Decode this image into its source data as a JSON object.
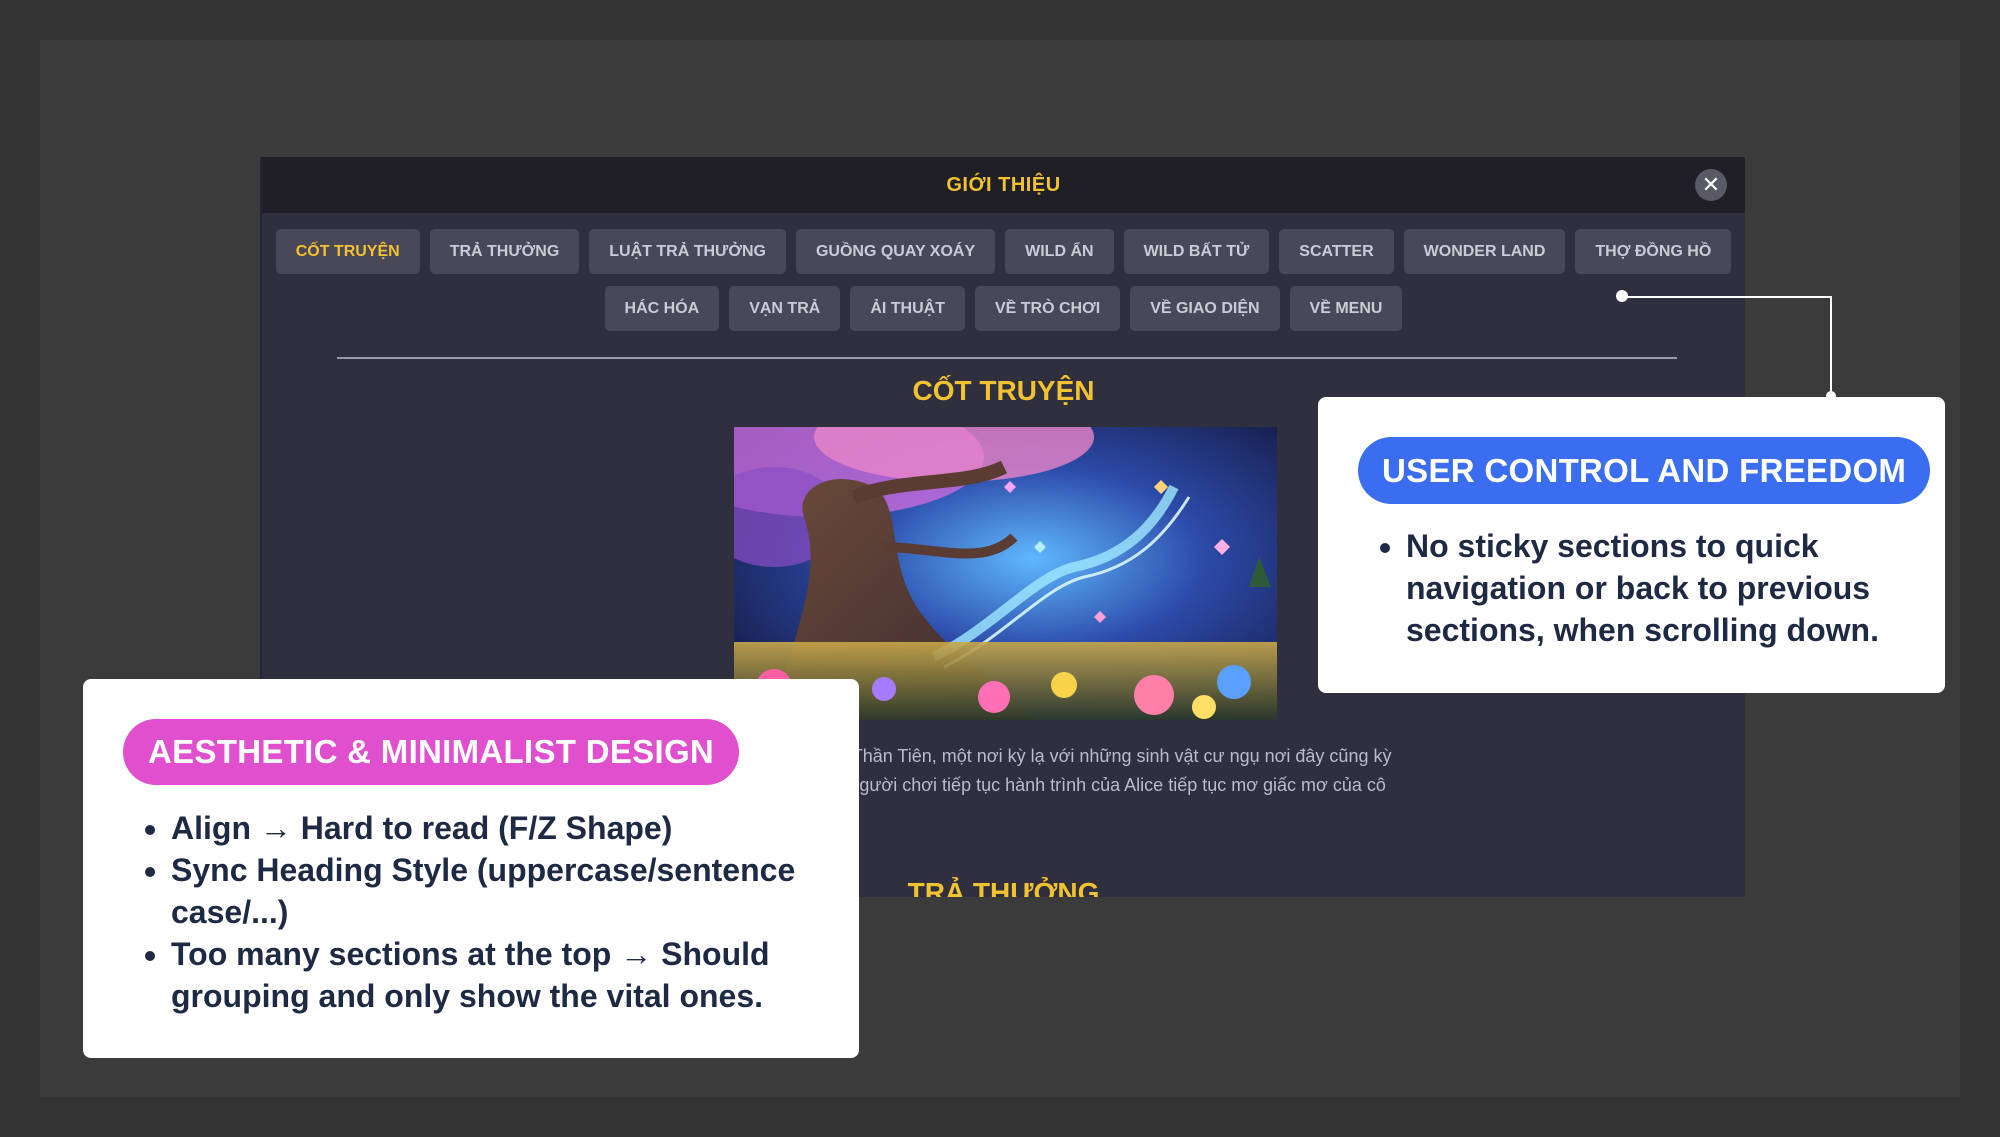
{
  "modal": {
    "title": "GIỚI THIỆU",
    "close_label": "✕",
    "tabs": [
      {
        "label": "CỐT TRUYỆN",
        "active": true
      },
      {
        "label": "TRẢ THƯỞNG",
        "active": false
      },
      {
        "label": "LUẬT TRẢ THƯỞNG",
        "active": false
      },
      {
        "label": "GUỒNG QUAY XOÁY",
        "active": false
      },
      {
        "label": "WILD ẨN",
        "active": false
      },
      {
        "label": "WILD BẤT TỬ",
        "active": false
      },
      {
        "label": "SCATTER",
        "active": false
      },
      {
        "label": "WONDER LAND",
        "active": false
      },
      {
        "label": "THỢ ĐỒNG HỒ",
        "active": false
      },
      {
        "label": "HÁC HÓA",
        "active": false
      },
      {
        "label": "VẠN TRẢ",
        "active": false
      },
      {
        "label": "ẢI THUẬT",
        "active": false
      },
      {
        "label": "VỀ TRÒ CHƠI",
        "active": false
      },
      {
        "label": "VỀ GIAO DIỆN",
        "active": false
      },
      {
        "label": "VỀ MENU",
        "active": false
      }
    ],
    "section_title": "CỐT TRUYỆN",
    "story_line1": "o Thỏ Trắng và bước vào xứ sở Thần Tiên, một nơi kỳ lạ với những sinh vật cư ngụ nơi đây cũng kỳ",
    "story_line2": "hẳng áp dụng được ở nơi đây. Người chơi tiếp tục hành trình của Alice tiếp tục mơ giấc mơ của cô",
    "next_section_title": "TRẢ THƯỞNG"
  },
  "annotations": {
    "right": {
      "heading": "USER CONTROL AND FREEDOM",
      "color": "#3b6df0",
      "points": [
        "No sticky sections to quick navigation or back to previous sections, when scrolling down."
      ]
    },
    "left": {
      "heading": "AESTHETIC & MINIMALIST DESIGN",
      "color": "#e04fce",
      "points": [
        "Align → Hard to read (F/Z Shape)",
        "Sync Heading Style (uppercase/sentence case/...)",
        "Too many sections at the top → Should grouping and only show the vital ones."
      ]
    }
  },
  "colors": {
    "accent_gold": "#f2c230",
    "tab_bg": "#484858",
    "modal_bg": "#2f2f3e",
    "header_bg": "#1f1f25"
  }
}
